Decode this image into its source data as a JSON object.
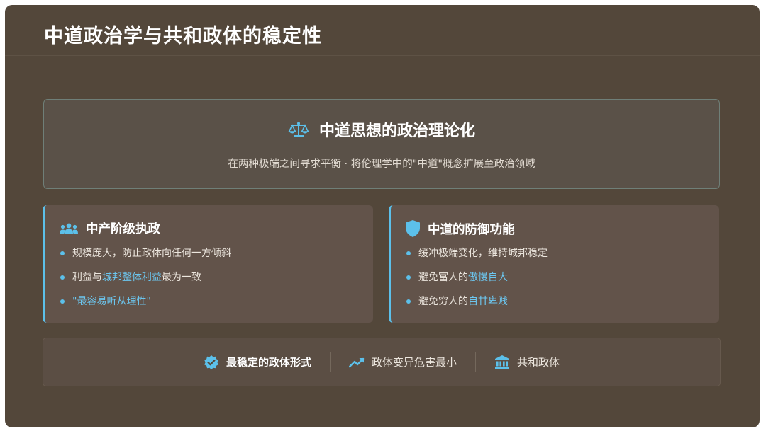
{
  "slide": {
    "title": "中道政治学与共和政体的稳定性"
  },
  "hero": {
    "icon": "balance-scale-icon",
    "title": "中道思想的政治理论化",
    "subtitle": "在两种极端之间寻求平衡 · 将伦理学中的\"中道\"概念扩展至政治领域"
  },
  "cards": [
    {
      "icon": "people-group-icon",
      "title": "中产阶级执政",
      "items": [
        {
          "parts": [
            {
              "text": "规模庞大，防止政体向任何一方倾斜",
              "hl": false
            }
          ]
        },
        {
          "parts": [
            {
              "text": "利益与",
              "hl": false
            },
            {
              "text": "城邦整体利益",
              "hl": true
            },
            {
              "text": "最为一致",
              "hl": false
            }
          ]
        },
        {
          "parts": [
            {
              "text": "\"最容易听从理性\"",
              "hl": true
            }
          ]
        }
      ]
    },
    {
      "icon": "shield-icon",
      "title": "中道的防御功能",
      "items": [
        {
          "parts": [
            {
              "text": "缓冲极端变化，维持城邦稳定",
              "hl": false
            }
          ]
        },
        {
          "parts": [
            {
              "text": "避免富人的",
              "hl": false
            },
            {
              "text": "傲慢自大",
              "hl": true
            }
          ]
        },
        {
          "parts": [
            {
              "text": "避免穷人的",
              "hl": false
            },
            {
              "text": "自甘卑贱",
              "hl": true
            }
          ]
        }
      ]
    }
  ],
  "footer": {
    "items": [
      {
        "icon": "verified-badge-icon",
        "label": "最稳定的政体形式"
      },
      {
        "icon": "trending-chart-icon",
        "label": "政体变异危害最小"
      },
      {
        "icon": "institution-building-icon",
        "label": "共和政体"
      }
    ]
  },
  "colors": {
    "background": "#53473a",
    "accent": "#5cc0ea",
    "card": "#62534a",
    "hero": "#5a5148"
  }
}
